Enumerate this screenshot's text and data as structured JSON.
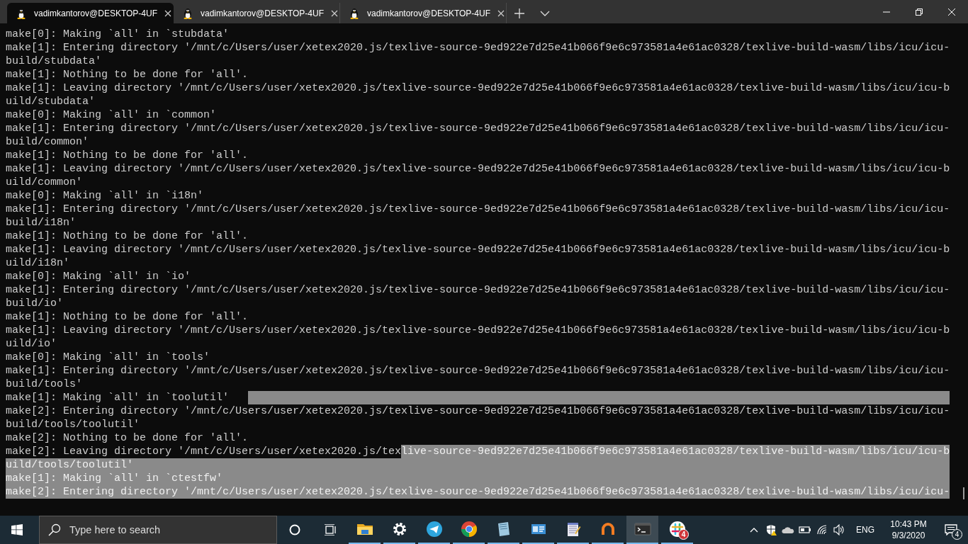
{
  "tabs": [
    {
      "title": "vadimkantorov@DESKTOP-4UF",
      "selected": true
    },
    {
      "title": "vadimkantorov@DESKTOP-4UF",
      "selected": false
    },
    {
      "title": "vadimkantorov@DESKTOP-4UF",
      "selected": false
    }
  ],
  "terminal": {
    "rows": [
      {
        "text": "make[0]: Making `all' in `stubdata'",
        "selected": false
      },
      {
        "text": "make[1]: Entering directory '/mnt/c/Users/user/xetex2020.js/texlive-source-9ed922e7d25e41b066f9e6c973581a4e61ac0328/texlive-build-wasm/libs/icu/icu-",
        "selected": false
      },
      {
        "text": "build/stubdata'",
        "selected": false
      },
      {
        "text": "make[1]: Nothing to be done for 'all'.",
        "selected": false
      },
      {
        "text": "make[1]: Leaving directory '/mnt/c/Users/user/xetex2020.js/texlive-source-9ed922e7d25e41b066f9e6c973581a4e61ac0328/texlive-build-wasm/libs/icu/icu-b",
        "selected": false
      },
      {
        "text": "uild/stubdata'",
        "selected": false
      },
      {
        "text": "make[0]: Making `all' in `common'",
        "selected": false
      },
      {
        "text": "make[1]: Entering directory '/mnt/c/Users/user/xetex2020.js/texlive-source-9ed922e7d25e41b066f9e6c973581a4e61ac0328/texlive-build-wasm/libs/icu/icu-",
        "selected": false
      },
      {
        "text": "build/common'",
        "selected": false
      },
      {
        "text": "make[1]: Nothing to be done for 'all'.",
        "selected": false
      },
      {
        "text": "make[1]: Leaving directory '/mnt/c/Users/user/xetex2020.js/texlive-source-9ed922e7d25e41b066f9e6c973581a4e61ac0328/texlive-build-wasm/libs/icu/icu-b",
        "selected": false
      },
      {
        "text": "uild/common'",
        "selected": false
      },
      {
        "text": "make[0]: Making `all' in `i18n'",
        "selected": false
      },
      {
        "text": "make[1]: Entering directory '/mnt/c/Users/user/xetex2020.js/texlive-source-9ed922e7d25e41b066f9e6c973581a4e61ac0328/texlive-build-wasm/libs/icu/icu-",
        "selected": false
      },
      {
        "text": "build/i18n'",
        "selected": false
      },
      {
        "text": "make[1]: Nothing to be done for 'all'.",
        "selected": false
      },
      {
        "text": "make[1]: Leaving directory '/mnt/c/Users/user/xetex2020.js/texlive-source-9ed922e7d25e41b066f9e6c973581a4e61ac0328/texlive-build-wasm/libs/icu/icu-b",
        "selected": false
      },
      {
        "text": "uild/i18n'",
        "selected": false
      },
      {
        "text": "make[0]: Making `all' in `io'",
        "selected": false
      },
      {
        "text": "make[1]: Entering directory '/mnt/c/Users/user/xetex2020.js/texlive-source-9ed922e7d25e41b066f9e6c973581a4e61ac0328/texlive-build-wasm/libs/icu/icu-",
        "selected": false
      },
      {
        "text": "build/io'",
        "selected": false
      },
      {
        "text": "make[1]: Nothing to be done for 'all'.",
        "selected": false
      },
      {
        "text": "make[1]: Leaving directory '/mnt/c/Users/user/xetex2020.js/texlive-source-9ed922e7d25e41b066f9e6c973581a4e61ac0328/texlive-build-wasm/libs/icu/icu-b",
        "selected": false
      },
      {
        "text": "uild/io'",
        "selected": false
      },
      {
        "text": "make[0]: Making `all' in `tools'",
        "selected": false
      },
      {
        "text": "make[1]: Entering directory '/mnt/c/Users/user/xetex2020.js/texlive-source-9ed922e7d25e41b066f9e6c973581a4e61ac0328/texlive-build-wasm/libs/icu/icu-",
        "selected": false
      },
      {
        "text": "build/tools'",
        "selected": false
      },
      {
        "text": "make[1]: Making `all' in `toolutil'",
        "selected": false,
        "selection_tail": true
      },
      {
        "text": "make[2]: Entering directory '/mnt/c/Users/user/xetex2020.js/texlive-source-9ed922e7d25e41b066f9e6c973581a4e61ac0328/texlive-build-wasm/libs/icu/icu-",
        "selected": false
      },
      {
        "text": "build/tools/toolutil'",
        "selected": false
      },
      {
        "text": "make[2]: Nothing to be done for 'all'.",
        "selected": false
      },
      {
        "segments": [
          {
            "text": "make[2]: Leaving directory '/mnt/c/Users/user/xetex2020.js/tex",
            "selected": false
          },
          {
            "text": "live-source-9ed922e7d25e41b066f9e6c973581a4e61ac0328/texlive-build-wasm/libs/icu/icu-b",
            "selected": true
          }
        ]
      },
      {
        "text": "uild/tools/toolutil'",
        "selected": true
      },
      {
        "text": "make[1]: Making `all' in `ctestfw'",
        "selected": true
      },
      {
        "text": "make[2]: Entering directory '/mnt/c/Users/user/xetex2020.js/texlive-source-9ed922e7d25e41b066f9e6c973581a4e61ac0328/texlive-build-wasm/libs/icu/icu-",
        "selected": true
      }
    ]
  },
  "taskbar": {
    "search": {
      "placeholder": "Type here to search"
    },
    "apps": [
      {
        "kind": "folder",
        "running": true,
        "active": false
      },
      {
        "kind": "gear",
        "running": true,
        "active": false
      },
      {
        "kind": "paper-plane",
        "running": true,
        "active": false
      },
      {
        "kind": "chrome",
        "running": true,
        "active": false
      },
      {
        "kind": "notepad-blue",
        "running": true,
        "active": false
      },
      {
        "kind": "card",
        "running": true,
        "active": false
      },
      {
        "kind": "notepad",
        "running": true,
        "active": false
      },
      {
        "kind": "ring",
        "running": true,
        "active": false
      },
      {
        "kind": "terminal",
        "running": true,
        "active": true
      },
      {
        "kind": "slack",
        "running": true,
        "active": false,
        "badge": "4"
      }
    ],
    "language": "ENG",
    "time": "10:43 PM",
    "date": "9/3/2020",
    "notification_count": "4"
  }
}
